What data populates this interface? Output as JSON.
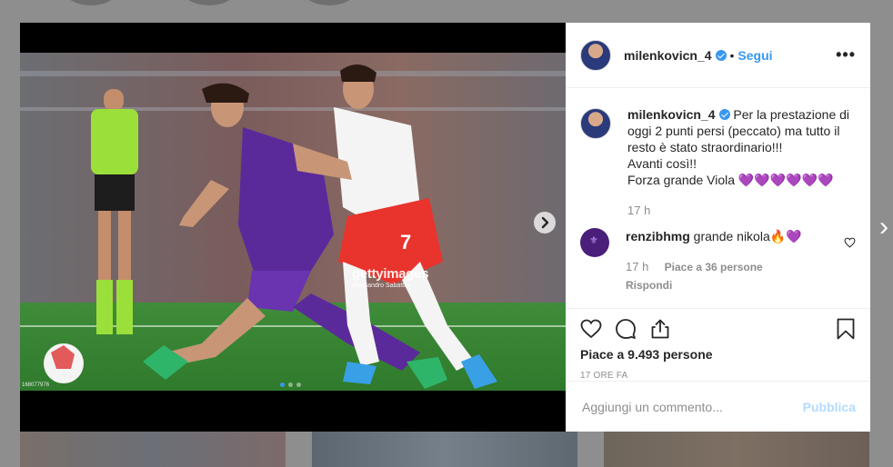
{
  "post": {
    "username": "milenkovicn_4",
    "follow_label": "Segui",
    "separator": "•",
    "more_label": "•••",
    "caption": {
      "line1": "Per la prestazione di",
      "line2": "oggi 2 punti persi (peccato) ma tutto il",
      "line3": "resto è stato straordinario!!!",
      "line4": "Avanti così!!",
      "line5": "Forza grande Viola 💜💜💜💜💜💜",
      "time": "17 h"
    },
    "comment": {
      "username": "renzibhmg",
      "text": "grande nikola🔥💜",
      "time": "17 h",
      "likes": "Piace a 36 persone",
      "reply": "Rispondi"
    },
    "likes_total": "Piace a 9.493 persone",
    "timestamp": "17 ORE FA",
    "add_comment_placeholder": "Aggiungi un commento...",
    "publish_label": "Pubblica"
  },
  "media": {
    "watermark_brand": "gettyimages",
    "watermark_credit": "Alessandro Sabattini",
    "image_id": "168077976",
    "carousel": {
      "total": 3,
      "current": 1
    }
  },
  "colors": {
    "accent": "#3897f0",
    "publish_disabled": "#b3dbff",
    "fiorentina_purple": "#5b2a9a",
    "juventus_red": "#e8342d"
  },
  "icons": [
    "verified-badge-icon",
    "more-options-icon",
    "carousel-next-icon",
    "heart-icon",
    "comment-icon",
    "share-icon",
    "bookmark-icon",
    "chevron-right-icon"
  ]
}
